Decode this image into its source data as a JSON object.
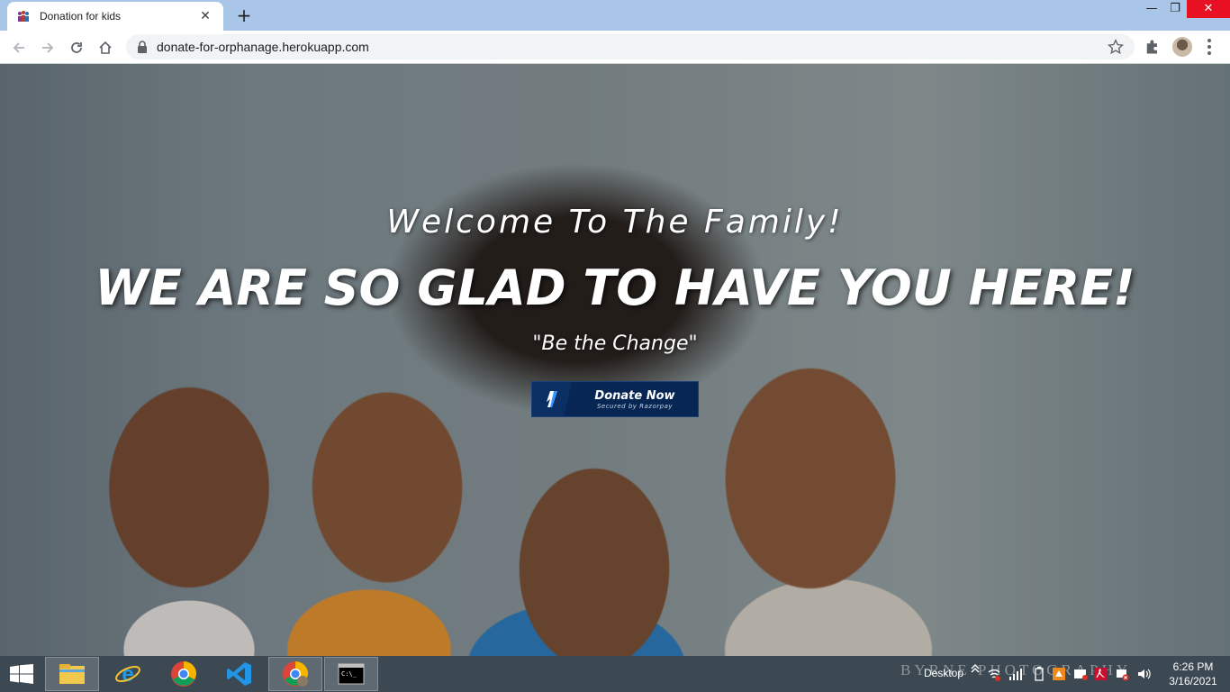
{
  "browser": {
    "tab_title": "Donation for kids",
    "tab_close": "✕",
    "new_tab": "+",
    "url": "donate-for-orphanage.herokuapp.com",
    "window_min": "—",
    "window_max": "❐",
    "window_close": "✕"
  },
  "hero": {
    "welcome": "Welcome To The Family!",
    "headline": "WE ARE SO GLAD TO HAVE YOU HERE!",
    "quote": "\"Be the Change\"",
    "donate_label": "Donate Now",
    "donate_sub": "Secured by Razorpay",
    "button_color": "#072654"
  },
  "taskbar": {
    "tray_label": "Desktop",
    "watermark": "BYRNE PHOTOGRAPHY",
    "time": "6:26 PM",
    "date": "3/16/2021",
    "bg_color": "#3c4952"
  }
}
